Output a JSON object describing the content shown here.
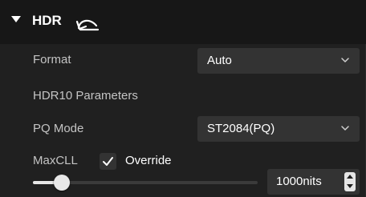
{
  "section": {
    "title": "HDR"
  },
  "format": {
    "label": "Format",
    "value": "Auto"
  },
  "hdr10": {
    "heading": "HDR10 Parameters"
  },
  "pq_mode": {
    "label": "PQ Mode",
    "value": "ST2084(PQ)"
  },
  "maxcll": {
    "label": "MaxCLL",
    "override_label": "Override",
    "override_checked": true,
    "value": "1000nits",
    "slider_fraction": 0.13
  },
  "colors": {
    "panel_bg": "#202020",
    "header_bg": "#171717",
    "control_bg": "#333333",
    "text_primary": "#ffffff",
    "text_secondary": "#c4c4c4"
  },
  "icons": {
    "collapse": "caret-down-icon",
    "reset": "undo-icon",
    "dropdown": "chevron-down-icon",
    "checkbox": "check-icon",
    "spin": "spin-arrows-icon"
  }
}
